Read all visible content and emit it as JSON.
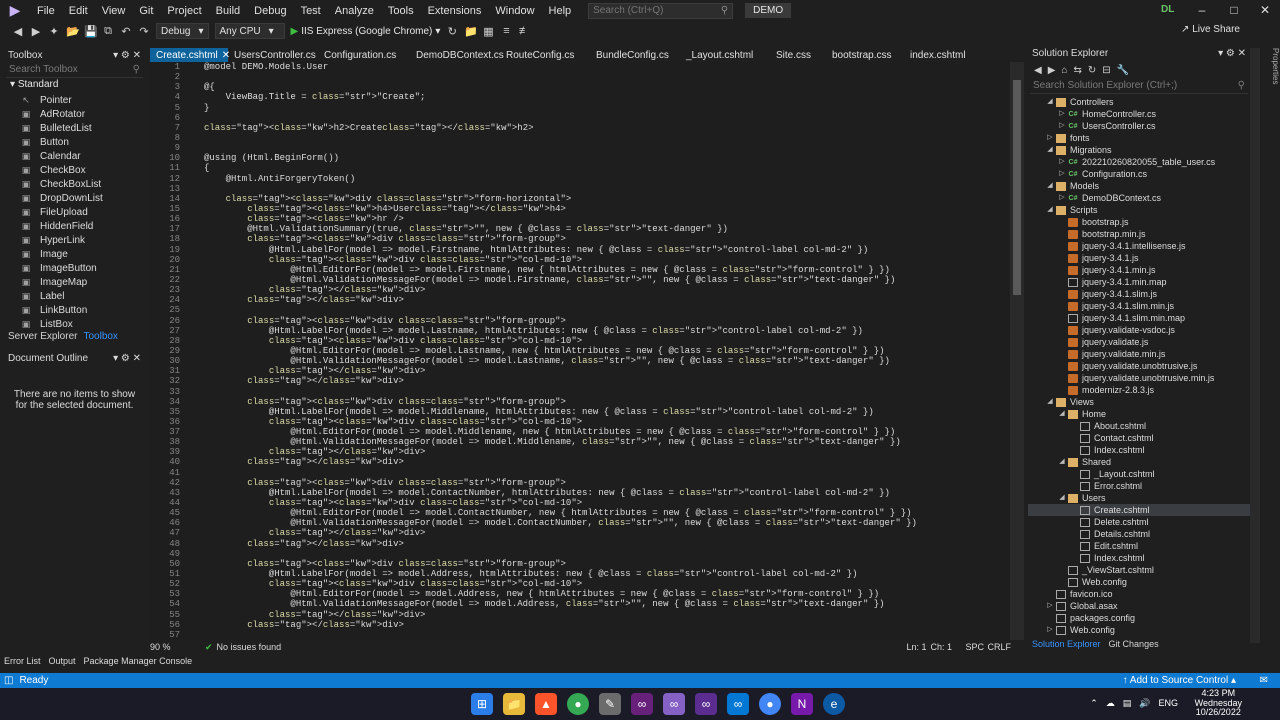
{
  "menu": [
    "File",
    "Edit",
    "View",
    "Git",
    "Project",
    "Build",
    "Debug",
    "Test",
    "Analyze",
    "Tools",
    "Extensions",
    "Window",
    "Help"
  ],
  "search": {
    "placeholder": "Search (Ctrl+Q)"
  },
  "solution_title": "DEMO",
  "user_initials": "DL",
  "toolbar": {
    "config": "Debug",
    "platform": "Any CPU",
    "run_target": "IIS Express (Google Chrome)",
    "live_share": "Live Share"
  },
  "toolbox": {
    "title": "Toolbox",
    "search_placeholder": "Search Toolbox",
    "category": "Standard",
    "items": [
      "Pointer",
      "AdRotator",
      "BulletedList",
      "Button",
      "Calendar",
      "CheckBox",
      "CheckBoxList",
      "DropDownList",
      "FileUpload",
      "HiddenField",
      "HyperLink",
      "Image",
      "ImageButton",
      "ImageMap",
      "Label",
      "LinkButton",
      "ListBox"
    ],
    "tabs": [
      "Server Explorer",
      "Toolbox"
    ]
  },
  "document_outline": {
    "title": "Document Outline",
    "message": "There are no items to show for the selected document."
  },
  "tabs": [
    "Create.cshtml",
    "UsersController.cs",
    "Configuration.cs",
    "DemoDBContext.cs",
    "RouteConfig.cs",
    "BundleConfig.cs",
    "_Layout.cshtml",
    "Site.css",
    "bootstrap.css",
    "index.cshtml"
  ],
  "code_lines": [
    "@model DEMO.Models.User",
    "",
    "@{",
    "    ViewBag.Title = \"Create\";",
    "}",
    "",
    "<h2>Create</h2>",
    "",
    "",
    "@using (Html.BeginForm())",
    "{",
    "    @Html.AntiForgeryToken()",
    "",
    "    <div class=\"form-horizontal\">",
    "        <h4>User</h4>",
    "        <hr />",
    "        @Html.ValidationSummary(true, \"\", new { @class = \"text-danger\" })",
    "        <div class=\"form-group\">",
    "            @Html.LabelFor(model => model.Firstname, htmlAttributes: new { @class = \"control-label col-md-2\" })",
    "            <div class=\"col-md-10\">",
    "                @Html.EditorFor(model => model.Firstname, new { htmlAttributes = new { @class = \"form-control\" } })",
    "                @Html.ValidationMessageFor(model => model.Firstname, \"\", new { @class = \"text-danger\" })",
    "            </div>",
    "        </div>",
    "",
    "        <div class=\"form-group\">",
    "            @Html.LabelFor(model => model.Lastname, htmlAttributes: new { @class = \"control-label col-md-2\" })",
    "            <div class=\"col-md-10\">",
    "                @Html.EditorFor(model => model.Lastname, new { htmlAttributes = new { @class = \"form-control\" } })",
    "                @Html.ValidationMessageFor(model => model.Lastname, \"\", new { @class = \"text-danger\" })",
    "            </div>",
    "        </div>",
    "",
    "        <div class=\"form-group\">",
    "            @Html.LabelFor(model => model.Middlename, htmlAttributes: new { @class = \"control-label col-md-2\" })",
    "            <div class=\"col-md-10\">",
    "                @Html.EditorFor(model => model.Middlename, new { htmlAttributes = new { @class = \"form-control\" } })",
    "                @Html.ValidationMessageFor(model => model.Middlename, \"\", new { @class = \"text-danger\" })",
    "            </div>",
    "        </div>",
    "",
    "        <div class=\"form-group\">",
    "            @Html.LabelFor(model => model.ContactNumber, htmlAttributes: new { @class = \"control-label col-md-2\" })",
    "            <div class=\"col-md-10\">",
    "                @Html.EditorFor(model => model.ContactNumber, new { htmlAttributes = new { @class = \"form-control\" } })",
    "                @Html.ValidationMessageFor(model => model.ContactNumber, \"\", new { @class = \"text-danger\" })",
    "            </div>",
    "        </div>",
    "",
    "        <div class=\"form-group\">",
    "            @Html.LabelFor(model => model.Address, htmlAttributes: new { @class = \"control-label col-md-2\" })",
    "            <div class=\"col-md-10\">",
    "                @Html.EditorFor(model => model.Address, new { htmlAttributes = new { @class = \"form-control\" } })",
    "                @Html.ValidationMessageFor(model => model.Address, \"\", new { @class = \"text-danger\" })",
    "            </div>",
    "        </div>",
    ""
  ],
  "editor_status": {
    "zoom": "90 %",
    "issues": "No issues found",
    "line": "Ln: 1",
    "col": "Ch: 1",
    "spc": "SPC",
    "eol": "CRLF"
  },
  "solution_explorer": {
    "title": "Solution Explorer",
    "search_placeholder": "Search Solution Explorer (Ctrl+;)",
    "nodes": [
      {
        "label": "Controllers",
        "type": "folder",
        "depth": 2,
        "arrow": "down"
      },
      {
        "label": "HomeController.cs",
        "type": "cs",
        "depth": 3,
        "arrow": "right"
      },
      {
        "label": "UsersController.cs",
        "type": "cs",
        "depth": 3,
        "arrow": "right"
      },
      {
        "label": "fonts",
        "type": "folder",
        "depth": 2,
        "arrow": "right"
      },
      {
        "label": "Migrations",
        "type": "folder",
        "depth": 2,
        "arrow": "down"
      },
      {
        "label": "202210260820055_table_user.cs",
        "type": "cs",
        "depth": 3,
        "arrow": "right"
      },
      {
        "label": "Configuration.cs",
        "type": "cs",
        "depth": 3,
        "arrow": "right"
      },
      {
        "label": "Models",
        "type": "folder",
        "depth": 2,
        "arrow": "down"
      },
      {
        "label": "DemoDBContext.cs",
        "type": "cs",
        "depth": 3,
        "arrow": "right"
      },
      {
        "label": "Scripts",
        "type": "folder",
        "depth": 2,
        "arrow": "down"
      },
      {
        "label": "bootstrap.js",
        "type": "js",
        "depth": 3,
        "arrow": ""
      },
      {
        "label": "bootstrap.min.js",
        "type": "js",
        "depth": 3,
        "arrow": ""
      },
      {
        "label": "jquery-3.4.1.intellisense.js",
        "type": "js",
        "depth": 3,
        "arrow": ""
      },
      {
        "label": "jquery-3.4.1.js",
        "type": "js",
        "depth": 3,
        "arrow": ""
      },
      {
        "label": "jquery-3.4.1.min.js",
        "type": "js",
        "depth": 3,
        "arrow": ""
      },
      {
        "label": "jquery-3.4.1.min.map",
        "type": "file",
        "depth": 3,
        "arrow": ""
      },
      {
        "label": "jquery-3.4.1.slim.js",
        "type": "js",
        "depth": 3,
        "arrow": ""
      },
      {
        "label": "jquery-3.4.1.slim.min.js",
        "type": "js",
        "depth": 3,
        "arrow": ""
      },
      {
        "label": "jquery-3.4.1.slim.min.map",
        "type": "file",
        "depth": 3,
        "arrow": ""
      },
      {
        "label": "jquery.validate-vsdoc.js",
        "type": "js",
        "depth": 3,
        "arrow": ""
      },
      {
        "label": "jquery.validate.js",
        "type": "js",
        "depth": 3,
        "arrow": ""
      },
      {
        "label": "jquery.validate.min.js",
        "type": "js",
        "depth": 3,
        "arrow": ""
      },
      {
        "label": "jquery.validate.unobtrusive.js",
        "type": "js",
        "depth": 3,
        "arrow": ""
      },
      {
        "label": "jquery.validate.unobtrusive.min.js",
        "type": "js",
        "depth": 3,
        "arrow": ""
      },
      {
        "label": "modernizr-2.8.3.js",
        "type": "js",
        "depth": 3,
        "arrow": ""
      },
      {
        "label": "Views",
        "type": "folder",
        "depth": 2,
        "arrow": "down"
      },
      {
        "label": "Home",
        "type": "folder",
        "depth": 3,
        "arrow": "down"
      },
      {
        "label": "About.cshtml",
        "type": "html",
        "depth": 4,
        "arrow": ""
      },
      {
        "label": "Contact.cshtml",
        "type": "html",
        "depth": 4,
        "arrow": ""
      },
      {
        "label": "Index.cshtml",
        "type": "html",
        "depth": 4,
        "arrow": ""
      },
      {
        "label": "Shared",
        "type": "folder",
        "depth": 3,
        "arrow": "down"
      },
      {
        "label": "_Layout.cshtml",
        "type": "html",
        "depth": 4,
        "arrow": ""
      },
      {
        "label": "Error.cshtml",
        "type": "html",
        "depth": 4,
        "arrow": ""
      },
      {
        "label": "Users",
        "type": "folder",
        "depth": 3,
        "arrow": "down"
      },
      {
        "label": "Create.cshtml",
        "type": "html",
        "depth": 4,
        "arrow": "",
        "selected": true
      },
      {
        "label": "Delete.cshtml",
        "type": "html",
        "depth": 4,
        "arrow": ""
      },
      {
        "label": "Details.cshtml",
        "type": "html",
        "depth": 4,
        "arrow": ""
      },
      {
        "label": "Edit.cshtml",
        "type": "html",
        "depth": 4,
        "arrow": ""
      },
      {
        "label": "Index.cshtml",
        "type": "html",
        "depth": 4,
        "arrow": ""
      },
      {
        "label": "_ViewStart.cshtml",
        "type": "html",
        "depth": 3,
        "arrow": ""
      },
      {
        "label": "Web.config",
        "type": "file",
        "depth": 3,
        "arrow": ""
      },
      {
        "label": "favicon.ico",
        "type": "file",
        "depth": 2,
        "arrow": ""
      },
      {
        "label": "Global.asax",
        "type": "file",
        "depth": 2,
        "arrow": "right"
      },
      {
        "label": "packages.config",
        "type": "file",
        "depth": 2,
        "arrow": ""
      },
      {
        "label": "Web.config",
        "type": "file",
        "depth": 2,
        "arrow": "right"
      }
    ],
    "tabs": [
      "Solution Explorer",
      "Git Changes"
    ]
  },
  "properties_strip": "Properties",
  "bottom_tabs": [
    "Error List",
    "Output",
    "Package Manager Console"
  ],
  "status": {
    "ready": "Ready",
    "source_control": "Add to Source Control"
  },
  "taskbar": {
    "lang": "ENG",
    "time": "4:23 PM",
    "day": "Wednesday",
    "date": "10/26/2022"
  }
}
